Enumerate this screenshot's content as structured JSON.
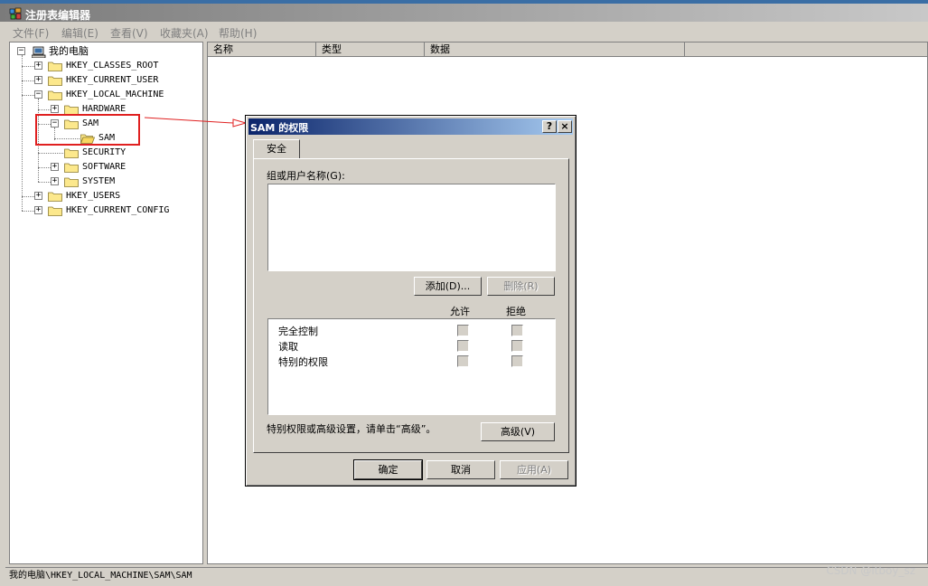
{
  "window": {
    "title": "注册表编辑器"
  },
  "menu": [
    {
      "label": "文件(F)"
    },
    {
      "label": "编辑(E)"
    },
    {
      "label": "查看(V)"
    },
    {
      "label": "收藏夹(A)"
    },
    {
      "label": "帮助(H)"
    }
  ],
  "tree": {
    "root": "我的电脑",
    "hkcr": "HKEY_CLASSES_ROOT",
    "hkcu": "HKEY_CURRENT_USER",
    "hklm": "HKEY_LOCAL_MACHINE",
    "hardware": "HARDWARE",
    "sam": "SAM",
    "sam_child": "SAM",
    "security": "SECURITY",
    "software": "SOFTWARE",
    "system": "SYSTEM",
    "hku": "HKEY_USERS",
    "hkcc": "HKEY_CURRENT_CONFIG"
  },
  "list": {
    "col_name": "名称",
    "col_type": "类型",
    "col_data": "数据"
  },
  "statusbar": {
    "path": "我的电脑\\HKEY_LOCAL_MACHINE\\SAM\\SAM"
  },
  "watermark": "CSDN @itboy_sz",
  "dialog": {
    "title": "SAM 的权限",
    "help_btn": "?",
    "close_btn": "×",
    "tab": "安全",
    "group_label": "组或用户名称(G):",
    "add_btn": "添加(D)...",
    "remove_btn": "删除(R)",
    "col_allow": "允许",
    "col_deny": "拒绝",
    "permissions": [
      {
        "name": "完全控制"
      },
      {
        "name": "读取"
      },
      {
        "name": "特别的权限"
      }
    ],
    "advanced_text": "特别权限或高级设置，请单击“高级”。",
    "advanced_btn": "高级(V)",
    "ok_btn": "确定",
    "cancel_btn": "取消",
    "apply_btn": "应用(A)"
  },
  "colors": {
    "highlight_box": "#e02020",
    "dialog_title_start": "#0a246a"
  }
}
